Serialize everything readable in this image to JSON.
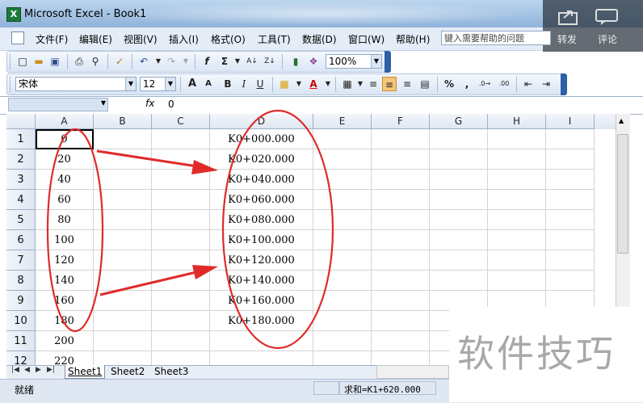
{
  "window": {
    "title": "Microsoft Excel - Book1"
  },
  "overlay": {
    "share_label": "转发",
    "comment_label": "评论"
  },
  "menu": [
    "文件(F)",
    "编辑(E)",
    "视图(V)",
    "插入(I)",
    "格式(O)",
    "工具(T)",
    "数据(D)",
    "窗口(W)",
    "帮助(H)"
  ],
  "help_search": {
    "placeholder": "键入需要帮助的问题"
  },
  "toolbar": {
    "zoom": "100%"
  },
  "format_bar": {
    "font_name": "宋体",
    "font_size": "12",
    "bold": "B",
    "italic": "I",
    "underline": "U",
    "percent": "%",
    "comma": ",",
    "font_grow": "A",
    "font_shrink": "A",
    "font_color": "A"
  },
  "formula_bar": {
    "fx": "fx",
    "value": "0"
  },
  "columns": [
    "A",
    "B",
    "C",
    "D",
    "E",
    "F",
    "G",
    "H",
    "I"
  ],
  "rows": [
    {
      "num": "1",
      "A": "0",
      "D": "K0+000.000"
    },
    {
      "num": "2",
      "A": "20",
      "D": "K0+020.000"
    },
    {
      "num": "3",
      "A": "40",
      "D": "K0+040.000"
    },
    {
      "num": "4",
      "A": "60",
      "D": "K0+060.000"
    },
    {
      "num": "5",
      "A": "80",
      "D": "K0+080.000"
    },
    {
      "num": "6",
      "A": "100",
      "D": "K0+100.000"
    },
    {
      "num": "7",
      "A": "120",
      "D": "K0+120.000"
    },
    {
      "num": "8",
      "A": "140",
      "D": "K0+140.000"
    },
    {
      "num": "9",
      "A": "160",
      "D": "K0+160.000"
    },
    {
      "num": "10",
      "A": "180",
      "D": "K0+180.000"
    },
    {
      "num": "11",
      "A": "200",
      "D": ""
    },
    {
      "num": "12",
      "A": "220",
      "D": ""
    }
  ],
  "sheets": [
    "Sheet1",
    "Sheet2",
    "Sheet3"
  ],
  "status": {
    "ready": "就绪",
    "sum": "求和=K1+620.000"
  },
  "watermark": "软件技巧",
  "annotation_color": "#e02a2a"
}
